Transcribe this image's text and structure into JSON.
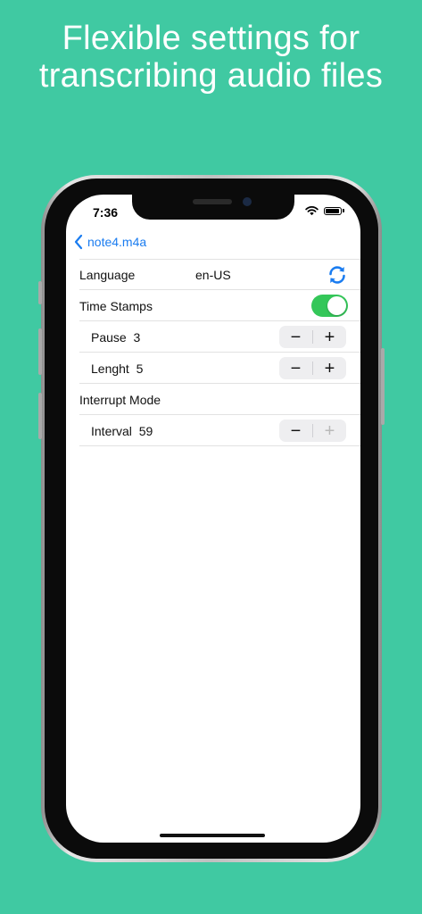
{
  "headline": {
    "line1": "Flexible settings for",
    "line2": "transcribing audio files"
  },
  "status_bar": {
    "time": "7:36",
    "icons": [
      "wifi-icon",
      "battery-icon"
    ]
  },
  "nav": {
    "back_label": "note4.m4a",
    "back_icon": "chevron-left-icon"
  },
  "settings": {
    "language": {
      "label": "Language",
      "value": "en-US",
      "action_icon": "sync-icon"
    },
    "time_stamps": {
      "label": "Time Stamps",
      "toggle_on": true
    },
    "pause": {
      "label": "Pause",
      "value": "3",
      "minus": "−",
      "plus": "+"
    },
    "length": {
      "label": "Lenght",
      "value": "5",
      "minus": "−",
      "plus": "+"
    },
    "interrupt_mode": {
      "label": "Interrupt Mode"
    },
    "interval": {
      "label": "Interval",
      "value": "59",
      "minus": "−",
      "plus": "+",
      "plus_disabled": true
    }
  },
  "colors": {
    "background": "#40c9a2",
    "accent": "#1a7cf0",
    "toggle_on": "#34c759"
  }
}
